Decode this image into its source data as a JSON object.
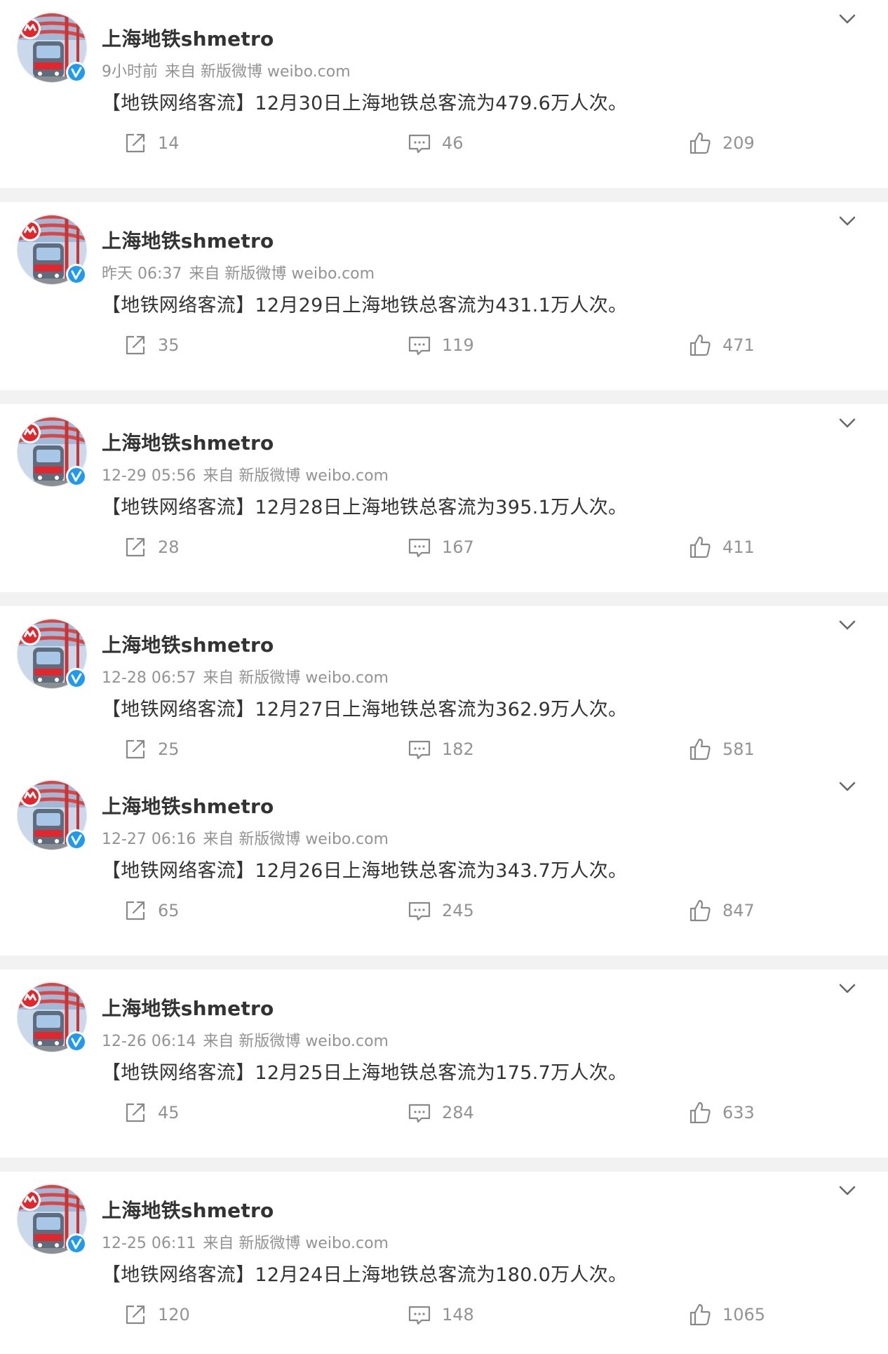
{
  "colors": {
    "page_bg": "#f2f2f2",
    "card_bg": "#ffffff",
    "name": "#333333",
    "meta": "#939393",
    "verified": "#1e9bf0",
    "metro_red": "#e3262b"
  },
  "icons": {
    "repost": "repost-icon",
    "comment": "comment-icon",
    "like": "thumbs-up-icon",
    "more": "chevron-down-icon",
    "verified": "verified-badge-icon"
  },
  "posts": [
    {
      "author": "上海地铁shmetro",
      "time": "9小时前",
      "source": "来自 新版微博 weibo.com",
      "text": "【地铁网络客流】12月30日上海地铁总客流为479.6万人次。",
      "reposts": "14",
      "comments": "46",
      "likes": "209"
    },
    {
      "author": "上海地铁shmetro",
      "time": "昨天 06:37",
      "source": "来自 新版微博 weibo.com",
      "text": "【地铁网络客流】12月29日上海地铁总客流为431.1万人次。",
      "reposts": "35",
      "comments": "119",
      "likes": "471"
    },
    {
      "author": "上海地铁shmetro",
      "time": "12-29 05:56",
      "source": "来自 新版微博 weibo.com",
      "text": "【地铁网络客流】12月28日上海地铁总客流为395.1万人次。",
      "reposts": "28",
      "comments": "167",
      "likes": "411"
    },
    {
      "author": "上海地铁shmetro",
      "time": "12-28 06:57",
      "source": "来自 新版微博 weibo.com",
      "text": "【地铁网络客流】12月27日上海地铁总客流为362.9万人次。",
      "reposts": "25",
      "comments": "182",
      "likes": "581"
    },
    {
      "author": "上海地铁shmetro",
      "time": "12-27 06:16",
      "source": "来自 新版微博 weibo.com",
      "text": "【地铁网络客流】12月26日上海地铁总客流为343.7万人次。",
      "reposts": "65",
      "comments": "245",
      "likes": "847"
    },
    {
      "author": "上海地铁shmetro",
      "time": "12-26 06:14",
      "source": "来自 新版微博 weibo.com",
      "text": "【地铁网络客流】12月25日上海地铁总客流为175.7万人次。",
      "reposts": "45",
      "comments": "284",
      "likes": "633"
    },
    {
      "author": "上海地铁shmetro",
      "time": "12-25 06:11",
      "source": "来自 新版微博 weibo.com",
      "text": "【地铁网络客流】12月24日上海地铁总客流为180.0万人次。",
      "reposts": "120",
      "comments": "148",
      "likes": "1065"
    }
  ]
}
